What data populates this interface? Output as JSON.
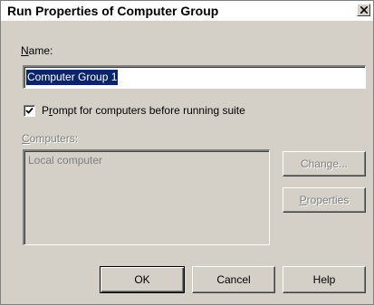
{
  "window": {
    "title": "Run Properties of Computer Group"
  },
  "name_field": {
    "label_mnemonic": "N",
    "label_rest": "ame:",
    "value": "Computer Group 1"
  },
  "prompt_checkbox": {
    "checked": true,
    "label_first": "P",
    "label_mnemonic": "r",
    "label_rest": "ompt for computers before running suite"
  },
  "computers": {
    "label_mnemonic": "C",
    "label_rest": "omputers:",
    "items": [
      "Local computer"
    ]
  },
  "buttons": {
    "change": "Change...",
    "properties_mnemonic": "P",
    "properties_rest": "roperties",
    "ok": "OK",
    "cancel": "Cancel",
    "help": "Help"
  }
}
